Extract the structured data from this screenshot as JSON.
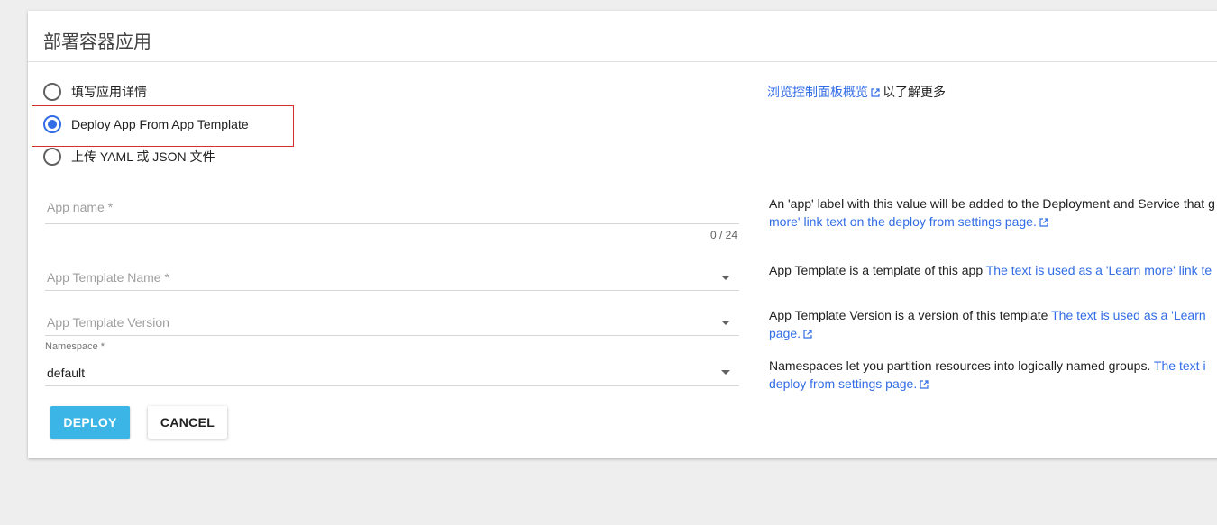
{
  "dialog": {
    "title": "部署容器应用"
  },
  "deploy_options": [
    {
      "label": "填写应用详情",
      "selected": false
    },
    {
      "label": "Deploy App From App Template",
      "selected": true
    },
    {
      "label": "上传 YAML 或 JSON 文件",
      "selected": false
    }
  ],
  "side_link": {
    "link_text": "浏览控制面板概览",
    "suffix": "以了解更多"
  },
  "form": {
    "app_name": {
      "placeholder": "App name *",
      "counter": "0 / 24"
    },
    "app_template_name": {
      "placeholder": "App Template Name *"
    },
    "app_template_version": {
      "placeholder": "App Template Version"
    },
    "namespace": {
      "label": "Namespace *",
      "value": "default"
    }
  },
  "help": {
    "app_name": {
      "line1": "An 'app' label with this value will be added to the Deployment and Service that g",
      "line2_link": "more' link text on the deploy from settings page."
    },
    "app_template_name": {
      "text": "App Template is a template of this app ",
      "link": "The text is used as a 'Learn more' link te"
    },
    "app_template_version": {
      "text": "App Template Version is a version of this template ",
      "link": "The text is used as a 'Learn",
      "line2_link": "page."
    },
    "namespace": {
      "text": "Namespaces let you partition resources into logically named groups. ",
      "link": "The text i",
      "line2_link": "deploy from settings page."
    }
  },
  "buttons": {
    "deploy": "DEPLOY",
    "cancel": "CANCEL"
  },
  "colors": {
    "accent": "#326de6",
    "primary_button": "#3ab5e6",
    "highlight_border": "#d32f2f"
  }
}
